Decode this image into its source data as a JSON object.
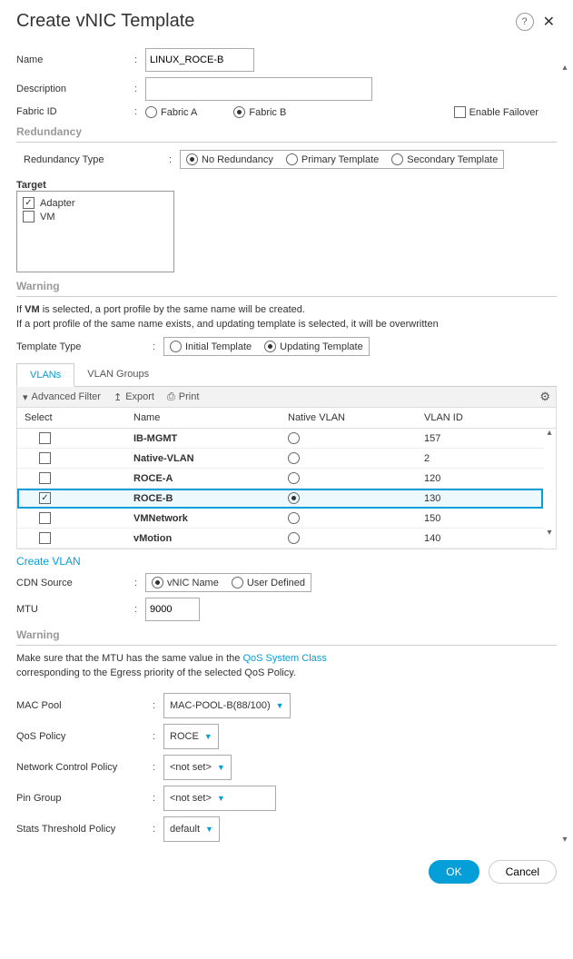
{
  "dialog": {
    "title": "Create vNIC Template",
    "help": "?",
    "close": "✕"
  },
  "form": {
    "name_label": "Name",
    "name_value": "LINUX_ROCE-B",
    "desc_label": "Description",
    "desc_value": "",
    "fabric_label": "Fabric ID",
    "fabric_a": "Fabric A",
    "fabric_b": "Fabric B",
    "enable_failover": "Enable Failover",
    "redundancy_head": "Redundancy",
    "redundancy_type_label": "Redundancy Type",
    "red_none": "No Redundancy",
    "red_primary": "Primary Template",
    "red_secondary": "Secondary Template",
    "target_label": "Target",
    "target_adapter": "Adapter",
    "target_vm": "VM",
    "warning_head": "Warning",
    "vm_warn1": "If VM is selected, a port profile by the same name will be created.",
    "vm_warn1_bold": "VM",
    "vm_warn1_pre": "If ",
    "vm_warn1_post": " is selected, a port profile by the same name will be created.",
    "vm_warn2": "If a port profile of the same name exists, and updating template is selected, it will be overwritten",
    "template_type_label": "Template Type",
    "tmpl_initial": "Initial Template",
    "tmpl_updating": "Updating Template",
    "tabs": {
      "vlans": "VLANs",
      "vlan_groups": "VLAN Groups"
    },
    "toolbar": {
      "filter": "Advanced Filter",
      "export": "Export",
      "print": "Print"
    },
    "grid": {
      "col_select": "Select",
      "col_name": "Name",
      "col_native": "Native VLAN",
      "col_id": "VLAN ID",
      "rows": [
        {
          "name": "IB-MGMT",
          "id": "157",
          "sel": false,
          "native": false
        },
        {
          "name": "Native-VLAN",
          "id": "2",
          "sel": false,
          "native": false
        },
        {
          "name": "ROCE-A",
          "id": "120",
          "sel": false,
          "native": false
        },
        {
          "name": "ROCE-B",
          "id": "130",
          "sel": true,
          "native": true
        },
        {
          "name": "VMNetwork",
          "id": "150",
          "sel": false,
          "native": false
        },
        {
          "name": "vMotion",
          "id": "140",
          "sel": false,
          "native": false
        }
      ]
    },
    "create_vlan": "Create VLAN",
    "cdn_label": "CDN Source",
    "cdn_vnic": "vNIC Name",
    "cdn_user": "User Defined",
    "mtu_label": "MTU",
    "mtu_value": "9000",
    "mtu_warn_head": "Warning",
    "mtu_warn1_pre": "Make sure that the MTU has the same value in the ",
    "mtu_warn1_link": "QoS System Class",
    "mtu_warn2": "corresponding to the Egress priority of the selected QoS Policy.",
    "mac_label": "MAC Pool",
    "mac_value": "MAC-POOL-B(88/100)",
    "qos_label": "QoS Policy",
    "qos_value": "ROCE",
    "ncp_label": "Network Control Policy",
    "ncp_value": "<not set>",
    "pin_label": "Pin Group",
    "pin_value": "<not set>",
    "stats_label": "Stats Threshold Policy",
    "stats_value": "default"
  },
  "footer": {
    "ok": "OK",
    "cancel": "Cancel"
  }
}
